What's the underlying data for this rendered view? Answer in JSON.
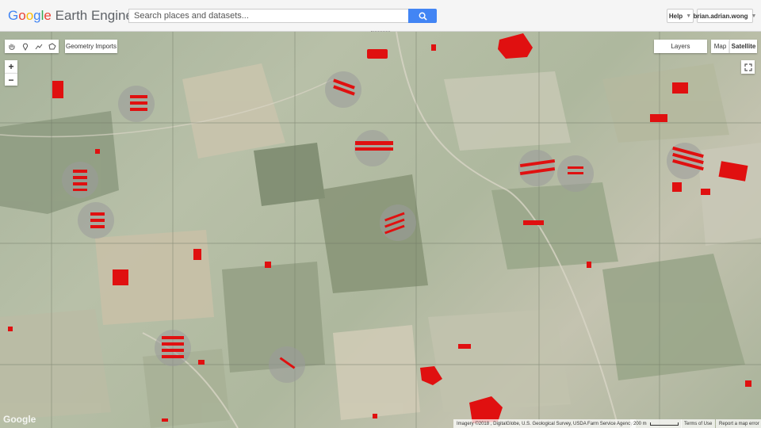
{
  "app": {
    "logo_google": "Google",
    "logo_rest": " Earth Engine"
  },
  "header": {
    "search_placeholder": "Search places and datasets...",
    "help_label": "Help",
    "user_label": "brian.adrian.wong"
  },
  "map": {
    "geometry_imports_label": "Geometry Imports",
    "layers_label": "Layers",
    "map_type_map": "Map",
    "map_type_satellite": "Satellite",
    "selected_map_type": "Satellite",
    "zoom_in": "+",
    "zoom_out": "−",
    "watermark": "Google",
    "attribution": "Imagery ©2018 , DigitalGlobe, U.S. Geological Survey, USDA Farm Service Agency",
    "scale_label": "200 m",
    "terms_label": "Terms of Use",
    "report_label": "Report a map error"
  },
  "colors": {
    "accent": "#4285f4",
    "overlay_red": "#e01010"
  },
  "icons": [
    "search-icon",
    "hand-icon",
    "pin-icon",
    "line-icon",
    "polygon-icon",
    "fullscreen-icon"
  ]
}
